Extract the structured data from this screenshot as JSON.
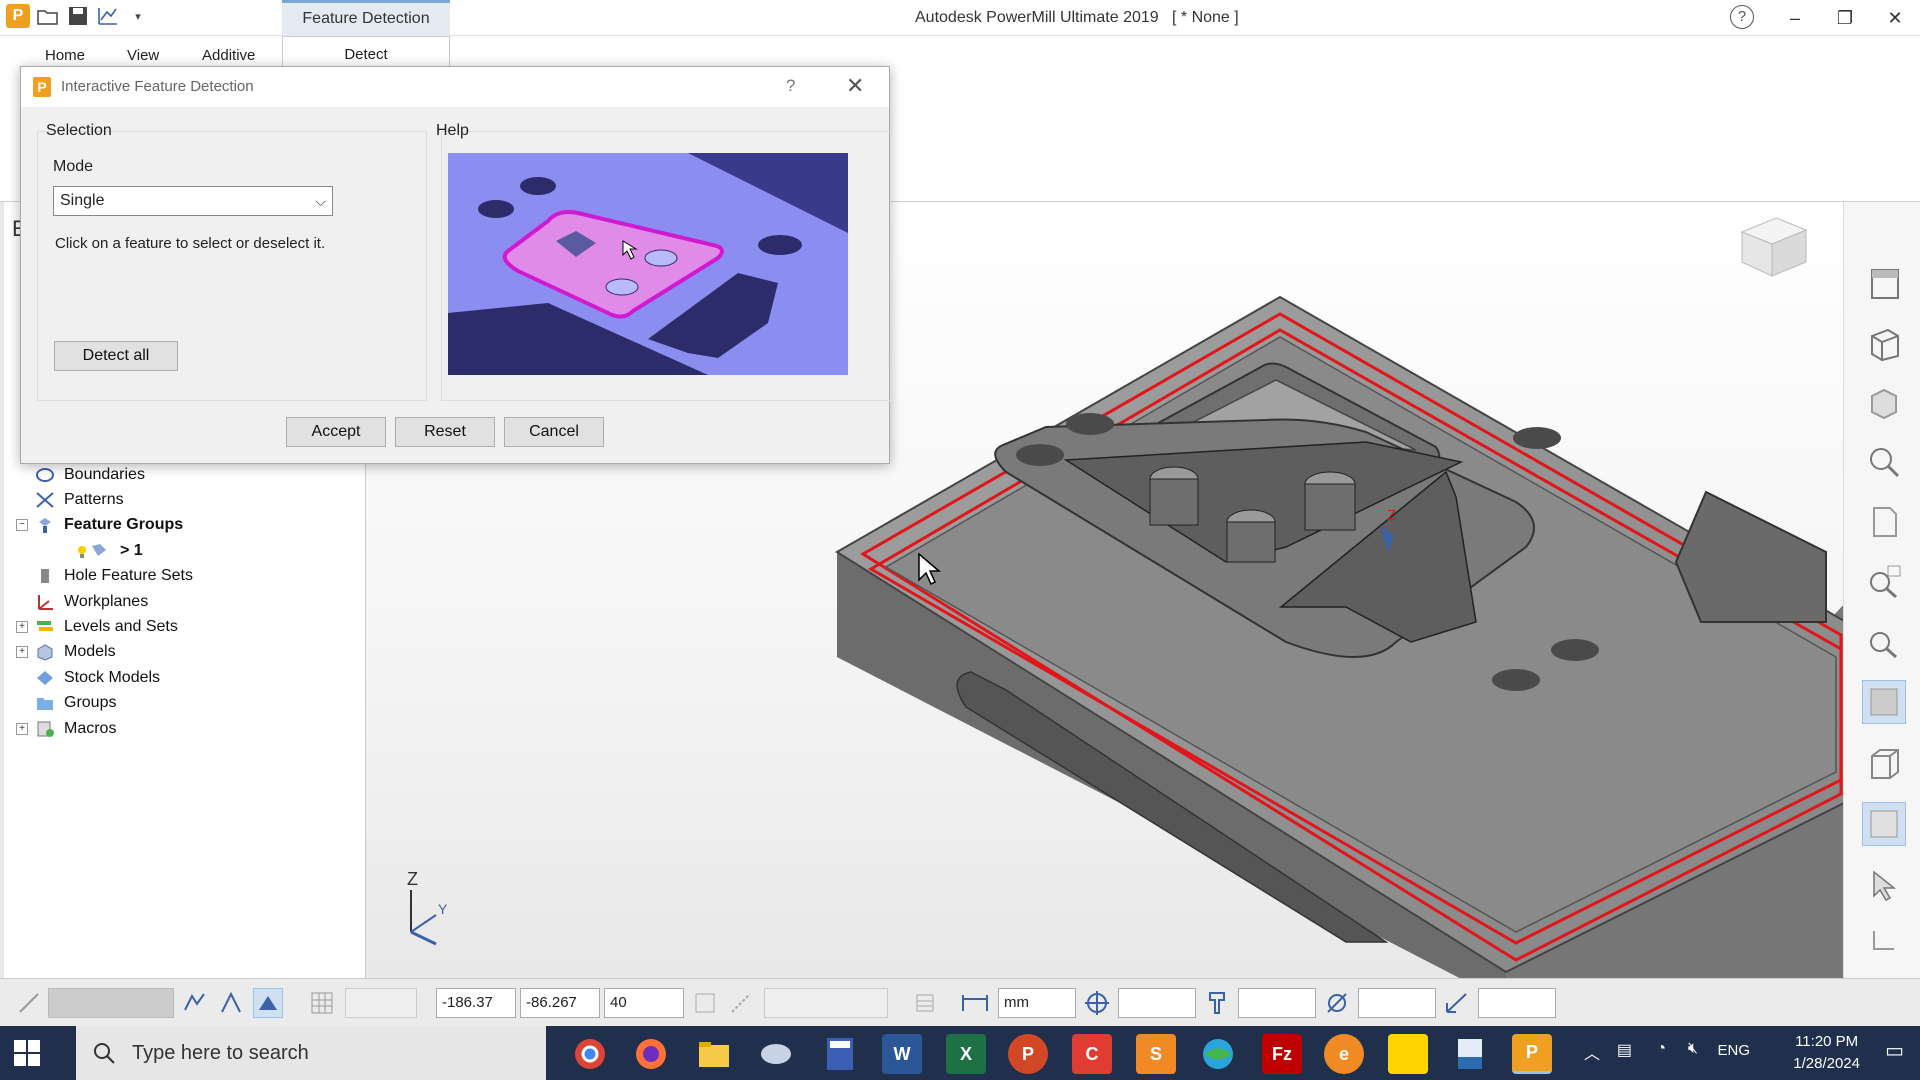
{
  "window": {
    "title": "Autodesk PowerMill Ultimate 2019",
    "project": "[ * None ]",
    "context_tab_group": "Feature Detection"
  },
  "ribbon": {
    "tabs": [
      "Home",
      "View",
      "Additive",
      "Detect"
    ],
    "active_tab": "Detect"
  },
  "dialog": {
    "title": "Interactive Feature Detection",
    "help_button": "?",
    "selection_label": "Selection",
    "help_label": "Help",
    "mode_label": "Mode",
    "mode_value": "Single",
    "instruction": "Click on a feature to select or deselect it.",
    "detect_all": "Detect all",
    "accept": "Accept",
    "reset": "Reset",
    "cancel": "Cancel"
  },
  "explorer": {
    "header_fragment": "E",
    "items": [
      {
        "label": "Boundaries",
        "icon": "boundary-icon",
        "expander": "",
        "bold": false
      },
      {
        "label": "Patterns",
        "icon": "pattern-icon",
        "expander": "",
        "bold": false
      },
      {
        "label": "Feature Groups",
        "icon": "feature-group-icon",
        "expander": "−",
        "bold": true
      },
      {
        "label": "> 1",
        "icon": "feature-group-child-icon",
        "expander": "",
        "bold": true,
        "child": true
      },
      {
        "label": "Hole Feature Sets",
        "icon": "hole-feature-icon",
        "expander": "",
        "bold": false
      },
      {
        "label": "Workplanes",
        "icon": "workplane-icon",
        "expander": "",
        "bold": false
      },
      {
        "label": "Levels and Sets",
        "icon": "levels-icon",
        "expander": "+",
        "bold": false
      },
      {
        "label": "Models",
        "icon": "model-icon",
        "expander": "+",
        "bold": false
      },
      {
        "label": "Stock Models",
        "icon": "stock-model-icon",
        "expander": "",
        "bold": false
      },
      {
        "label": "Groups",
        "icon": "folder-icon",
        "expander": "",
        "bold": false
      },
      {
        "label": "Macros",
        "icon": "macro-icon",
        "expander": "+",
        "bold": false
      }
    ]
  },
  "viewport": {
    "axis_label_z": "Z",
    "axis_label_y": "Y",
    "cursor_axis_label": "Z"
  },
  "statusbar": {
    "x": "-186.37",
    "y": "-86.267",
    "z": "40",
    "units": "mm"
  },
  "taskbar": {
    "search_placeholder": "Type here to search",
    "language": "ENG",
    "time": "11:20 PM",
    "date": "1/28/2024"
  },
  "colors": {
    "feature_outline": "#e0161b",
    "part_gray": "#8a8a8a",
    "help_purple": "#8b8ef0",
    "accent": "#f0a020"
  }
}
